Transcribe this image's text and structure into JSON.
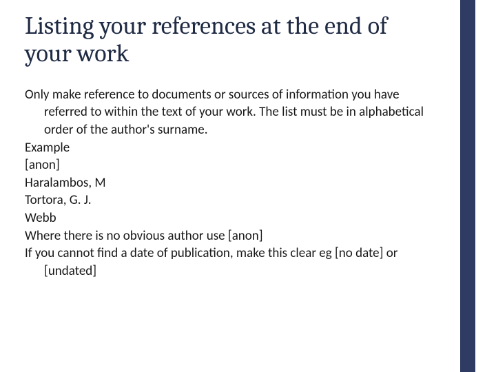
{
  "title": "Listing your references at the end of your work",
  "body": {
    "intro": "Only make reference to documents or sources of information you have referred to within the text of your work. The list must be in alphabetical order of the author's surname.",
    "example_label": "Example",
    "examples": [
      "[anon]",
      "Haralambos, M",
      "Tortora, G. J.",
      "Webb"
    ],
    "note_anon": "Where there is no obvious author use [anon]",
    "note_nodate": "If you cannot find a date of publication, make this clear eg [no date] or [undated]"
  }
}
